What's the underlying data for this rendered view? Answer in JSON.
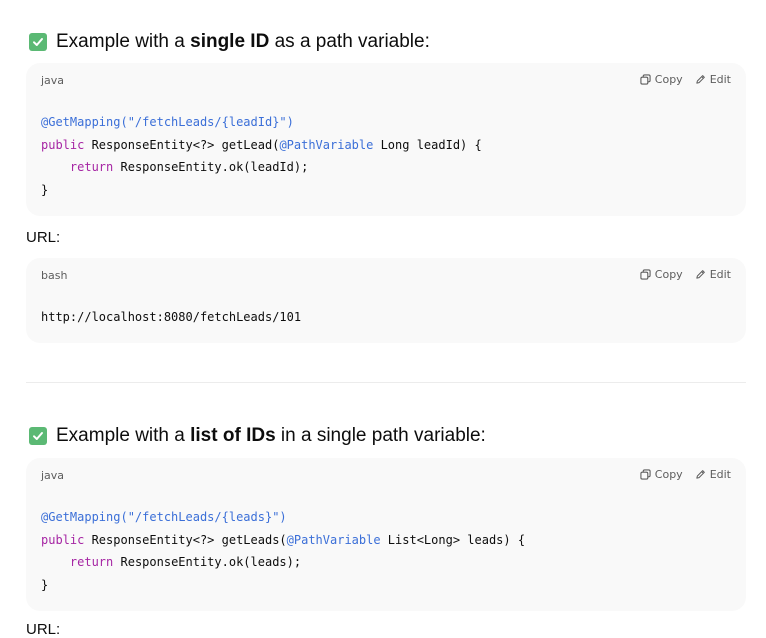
{
  "section1": {
    "heading_prefix": "Example with a ",
    "heading_bold": "single ID",
    "heading_suffix": " as a path variable:",
    "code1": {
      "lang": "java",
      "copy_label": "Copy",
      "edit_label": "Edit",
      "lines": {
        "l1_ann": "@GetMapping(\"/fetchLeads/{leadId}\")",
        "l2_kw": "public",
        "l2_a": " ResponseEntity<?> getLead(",
        "l2_ann": "@PathVariable",
        "l2_b": " Long leadId) {",
        "l3_indent": "    ",
        "l3_kw": "return",
        "l3_rest": " ResponseEntity.ok(leadId);",
        "l4": "}"
      }
    },
    "url_label": "URL:",
    "code2": {
      "lang": "bash",
      "copy_label": "Copy",
      "edit_label": "Edit",
      "text": "http://localhost:8080/fetchLeads/101"
    }
  },
  "section2": {
    "heading_prefix": "Example with a ",
    "heading_bold": "list of IDs",
    "heading_suffix": " in a single path variable:",
    "code1": {
      "lang": "java",
      "copy_label": "Copy",
      "edit_label": "Edit",
      "lines": {
        "l1_ann": "@GetMapping(\"/fetchLeads/{leads}\")",
        "l2_kw": "public",
        "l2_a": " ResponseEntity<?> getLeads(",
        "l2_ann": "@PathVariable",
        "l2_b": " List<Long> leads) {",
        "l3_indent": "    ",
        "l3_kw": "return",
        "l3_rest": " ResponseEntity.ok(leads);",
        "l4": "}"
      }
    },
    "url_label": "URL:"
  },
  "colors": {
    "checkbox": "#5bb974",
    "annotation": "#3b6fd8",
    "keyword": "#a626a4",
    "code_bg": "#f9f9f9"
  }
}
